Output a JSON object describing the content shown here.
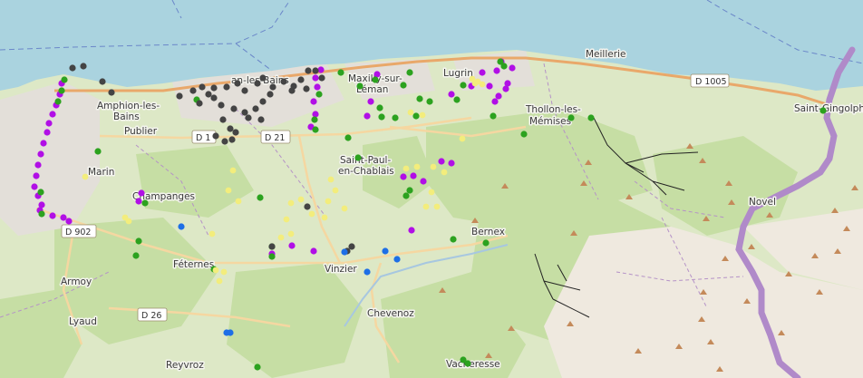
{
  "places": [
    {
      "name": "Meillerie",
      "id": "meillerie"
    },
    {
      "name": "Lugrin",
      "id": "lugrin"
    },
    {
      "name": "Maxilly-sur-",
      "id": "maxilly-1"
    },
    {
      "name": "Léman",
      "id": "maxilly-2"
    },
    {
      "name": "an-les-Bains",
      "id": "evian"
    },
    {
      "name": "Amphion-les-",
      "id": "amphion-1"
    },
    {
      "name": "Bains",
      "id": "amphion-2"
    },
    {
      "name": "Publier",
      "id": "publier"
    },
    {
      "name": "Thollon-les-",
      "id": "thollon-1"
    },
    {
      "name": "Mémises",
      "id": "thollon-2"
    },
    {
      "name": "Saint-Gingolph",
      "id": "saint-gingolph"
    },
    {
      "name": "Saint-Paul-",
      "id": "saint-paul-1"
    },
    {
      "name": "en-Chablais",
      "id": "saint-paul-2"
    },
    {
      "name": "Marin",
      "id": "marin"
    },
    {
      "name": "Champanges",
      "id": "champanges"
    },
    {
      "name": "Novel",
      "id": "novel"
    },
    {
      "name": "Bernex",
      "id": "bernex"
    },
    {
      "name": "Féternes",
      "id": "feternes"
    },
    {
      "name": "Vinzier",
      "id": "vinzier"
    },
    {
      "name": "Armoy",
      "id": "armoy"
    },
    {
      "name": "Lyaud",
      "id": "lyaud"
    },
    {
      "name": "Chevenoz",
      "id": "chevenoz"
    },
    {
      "name": "Reyvroz",
      "id": "reyvroz"
    },
    {
      "name": "Vacheresse",
      "id": "vacheresse"
    }
  ],
  "roads": [
    {
      "ref": "D 1005",
      "id": "d1005"
    },
    {
      "ref": "D 1",
      "id": "d1"
    },
    {
      "ref": "D 21",
      "id": "d21"
    },
    {
      "ref": "D 902",
      "id": "d902"
    },
    {
      "ref": "D 26",
      "id": "d26"
    }
  ],
  "map_colors": {
    "lake": "#aad3df",
    "land": "#dfe9c9",
    "forest": "#c5dea3",
    "urban": "#e4e0dc",
    "rock": "#f0ebe2",
    "border": "#b08ac9",
    "road": "#f6c98a"
  },
  "marker_colors": {
    "magenta": "#b10fe6",
    "green": "#2ca21f",
    "dark_gray": "#444444",
    "yellow": "#f3ed7c",
    "blue": "#1e6fe6"
  }
}
